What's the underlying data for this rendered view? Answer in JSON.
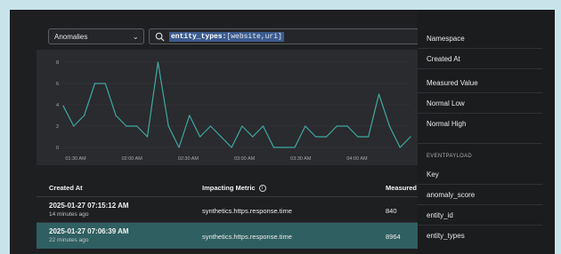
{
  "toolbar": {
    "dropdown_value": "Anomalies",
    "query_key": "entity_types:",
    "query_value": "[website,uri]"
  },
  "chart_data": {
    "type": "line",
    "x_tick_labels": [
      "01:30 AM",
      "02:00 AM",
      "02:30 AM",
      "03:00 AM",
      "03:30 AM",
      "04:00 AM"
    ],
    "y_tick_labels": [
      "0",
      "2",
      "4",
      "6",
      "8"
    ],
    "ylim": [
      0,
      8.5
    ],
    "values": [
      3.9,
      2.0,
      3.0,
      6.0,
      6.0,
      3.0,
      2.0,
      2.0,
      1.0,
      8.0,
      2.0,
      0.0,
      3.0,
      1.0,
      2.0,
      1.0,
      0.0,
      2.0,
      1.0,
      2.0,
      0.0,
      0.0,
      0.0,
      2.0,
      1.0,
      1.0,
      2.0,
      2.0,
      1.0,
      1.0,
      5.0,
      2.0,
      0.0,
      1.0
    ],
    "line_color": "#3fa9a3",
    "grid": true
  },
  "table": {
    "columns": [
      "Created At",
      "Impacting Metric",
      "Measured"
    ],
    "rows": [
      {
        "created": "2025-01-27 07:15:12 AM",
        "ago": "14 minutes ago",
        "metric": "synthetics.https.response.time",
        "value": "840"
      },
      {
        "created": "2025-01-27 07:06:39 AM",
        "ago": "22 minutes ago",
        "metric": "synthetics.https.response.time",
        "value": "8964"
      }
    ]
  },
  "side": {
    "fields": [
      "Namespace",
      "Created At",
      "Measured Value",
      "Normal Low",
      "Normal High"
    ],
    "section": "EVENTPAYLOAD",
    "payload_fields": [
      "Key",
      "anomaly_score",
      "entity_id",
      "entity_types"
    ]
  },
  "colors": {
    "background": "#1e1f21",
    "selected_row": "#2f5f61",
    "line": "#3fa9a3",
    "query_highlight": "#3c5b8e"
  }
}
